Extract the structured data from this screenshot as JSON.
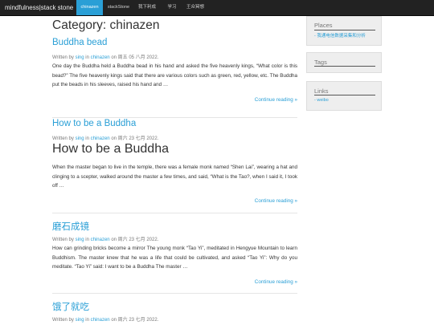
{
  "navbar": {
    "brand": "mindfulness|stack stone",
    "items": [
      {
        "label": "chinazen",
        "active": true
      },
      {
        "label": "stackStone",
        "active": false
      },
      {
        "label": "我下利成",
        "active": false
      },
      {
        "label": "学习",
        "active": false
      },
      {
        "label": "王众冥想",
        "active": false
      }
    ]
  },
  "page": {
    "title": "Category: chinazen"
  },
  "posts": [
    {
      "title": "Buddha bead",
      "meta_prefix": "Written by",
      "author": "sing",
      "in_word": "in",
      "category": "chinazen",
      "on_word": "on",
      "date": "周五 05 八月 2022.",
      "excerpt": "One day the Buddha held a Buddha bead in his hand and asked the five heavenly kings, “What color is this bead?” The five heavenly kings said that there are various colors such as green, red, yellow, etc. The Buddha put the beads in his sleeves, raised his hand and …",
      "continue": "Continue reading »"
    },
    {
      "title": "How to be a Buddha",
      "meta_prefix": "Written by",
      "author": "sing",
      "in_word": "in",
      "category": "chinazen",
      "on_word": "on",
      "date": "周六 23 七月 2022.",
      "heading": "How to be a Buddha",
      "excerpt": "When the master began to live in the temple, there was a female monk named “Shen Lai”, wearing a hat and clinging to a scepter, walked around the master a few times, and said, “What is the Tao?, when I said it, I took off …",
      "continue": "Continue reading »"
    },
    {
      "title": "磨石成镜",
      "meta_prefix": "Written by",
      "author": "sing",
      "in_word": "in",
      "category": "chinazen",
      "on_word": "on",
      "date": "周六 23 七月 2022.",
      "excerpt": "How can grinding bricks become a mirror The young monk “Tao Yi”, meditated in Hengyue Mountain to learn Buddhism. The master knew that he was a life that could be cultivated, and asked “Tao Yi”: Why do you meditate. “Tao Yi” said: I want to be a Buddha The master …",
      "continue": "Continue reading »"
    },
    {
      "title": "饿了就吃",
      "meta_prefix": "Written by",
      "author": "sing",
      "in_word": "in",
      "category": "chinazen",
      "on_word": "on",
      "date": "周六 23 七月 2022."
    }
  ],
  "sidebar": {
    "places": {
      "title": "Places",
      "links": [
        "- 我通电信数据采集和分析"
      ]
    },
    "tags": {
      "title": "Tags"
    },
    "links": {
      "title": "Links",
      "links": [
        "- weibo"
      ]
    }
  }
}
